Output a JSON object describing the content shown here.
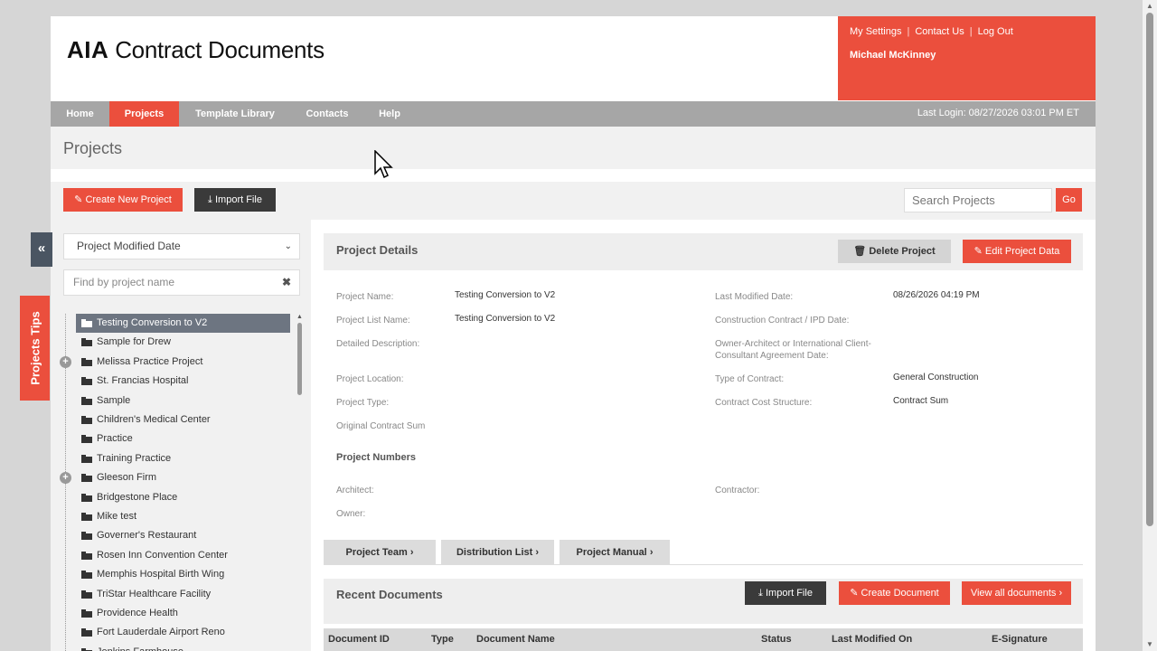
{
  "header": {
    "logo_bold": "AIA",
    "logo_rest": " Contract Documents",
    "user_links": [
      "My Settings",
      "Contact Us",
      "Log Out"
    ],
    "user_name": "Michael McKinney"
  },
  "nav": {
    "items": [
      "Home",
      "Projects",
      "Template Library",
      "Contacts",
      "Help"
    ],
    "active": "Projects",
    "last_login": "Last Login: 08/27/2026 03:01 PM ET"
  },
  "page_title": "Projects",
  "actions": {
    "create_new_project": "Create New Project",
    "import_file": "Import File",
    "search_placeholder": "Search Projects",
    "go": "Go"
  },
  "sidebar": {
    "sort_select": "Project Modified Date",
    "find_placeholder": "Find by project name",
    "tips_tab": "Projects Tips",
    "projects": [
      {
        "name": "Testing Conversion to V2",
        "selected": true,
        "expandable": false
      },
      {
        "name": "Sample for Drew",
        "selected": false,
        "expandable": false
      },
      {
        "name": "Melissa Practice Project",
        "selected": false,
        "expandable": true
      },
      {
        "name": "St. Francias Hospital",
        "selected": false,
        "expandable": false
      },
      {
        "name": "Sample",
        "selected": false,
        "expandable": false
      },
      {
        "name": "Children's Medical Center",
        "selected": false,
        "expandable": false
      },
      {
        "name": "Practice",
        "selected": false,
        "expandable": false
      },
      {
        "name": "Training Practice",
        "selected": false,
        "expandable": false
      },
      {
        "name": "Gleeson Firm",
        "selected": false,
        "expandable": true
      },
      {
        "name": "Bridgestone Place",
        "selected": false,
        "expandable": false
      },
      {
        "name": "Mike test",
        "selected": false,
        "expandable": false
      },
      {
        "name": "Governer's Restaurant",
        "selected": false,
        "expandable": false
      },
      {
        "name": "Rosen Inn Convention Center",
        "selected": false,
        "expandable": false
      },
      {
        "name": "Memphis Hospital Birth Wing",
        "selected": false,
        "expandable": false
      },
      {
        "name": "TriStar Healthcare Facility",
        "selected": false,
        "expandable": false
      },
      {
        "name": "Providence Health",
        "selected": false,
        "expandable": false
      },
      {
        "name": "Fort Lauderdale Airport Reno",
        "selected": false,
        "expandable": false
      },
      {
        "name": "Jenkins Farmhouse",
        "selected": false,
        "expandable": false
      }
    ]
  },
  "project_details": {
    "title": "Project Details",
    "delete_label": "Delete Project",
    "edit_label": "Edit Project Data",
    "fields_left": [
      {
        "label": "Project Name:",
        "value": "Testing Conversion to V2"
      },
      {
        "label": "Project List Name:",
        "value": "Testing Conversion to V2"
      },
      {
        "label": "Detailed Description:",
        "value": ""
      },
      {
        "label": "Project Location:",
        "value": ""
      },
      {
        "label": "Project Type:",
        "value": ""
      },
      {
        "label": "Original Contract Sum",
        "value": ""
      }
    ],
    "fields_right": [
      {
        "label": "Last Modified Date:",
        "value": "08/26/2026 04:19 PM"
      },
      {
        "label": "Construction Contract / IPD Date:",
        "value": ""
      },
      {
        "label": "Owner-Architect or International Client-Consultant Agreement Date:",
        "value": ""
      },
      {
        "label": "Type of Contract:",
        "value": "General Construction"
      },
      {
        "label": "Contract Cost Structure:",
        "value": "Contract Sum"
      }
    ],
    "project_numbers_title": "Project Numbers",
    "architect_label": "Architect:",
    "owner_label": "Owner:",
    "contractor_label": "Contractor:"
  },
  "sub_tabs": [
    "Project Team",
    "Distribution List",
    "Project Manual"
  ],
  "recent_documents": {
    "title": "Recent Documents",
    "import_file": "Import File",
    "create_document": "Create Document",
    "view_all": "View all documents",
    "columns": [
      "Document ID",
      "Type",
      "Document Name",
      "Status",
      "Last Modified On",
      "E-Signature"
    ]
  }
}
